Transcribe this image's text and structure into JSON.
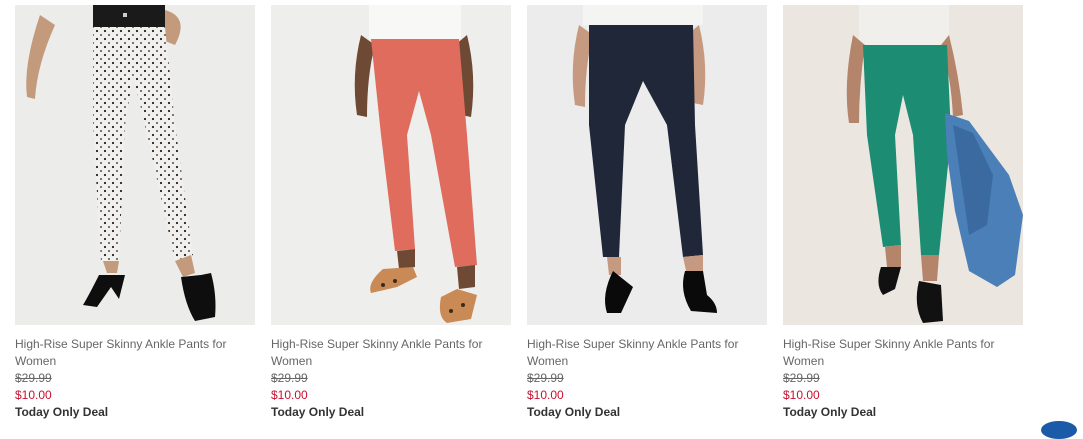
{
  "products": [
    {
      "title": "High-Rise Super Skinny Ankle Pants for Women",
      "original_price": "$29.99",
      "sale_price": "$10.00",
      "deal": "Today Only Deal",
      "image": "white-dot-print-pants-photo"
    },
    {
      "title": "High-Rise Super Skinny Ankle Pants for Women",
      "original_price": "$29.99",
      "sale_price": "$10.00",
      "deal": "Today Only Deal",
      "image": "coral-pants-photo"
    },
    {
      "title": "High-Rise Super Skinny Ankle Pants for Women",
      "original_price": "$29.99",
      "sale_price": "$10.00",
      "deal": "Today Only Deal",
      "image": "navy-pants-photo"
    },
    {
      "title": "High-Rise Super Skinny Ankle Pants for Women",
      "original_price": "$29.99",
      "sale_price": "$10.00",
      "deal": "Today Only Deal",
      "image": "green-pants-photo"
    }
  ],
  "colors": {
    "sale_price": "#c8102e",
    "text_muted": "#666666",
    "deal_text": "#333333"
  }
}
